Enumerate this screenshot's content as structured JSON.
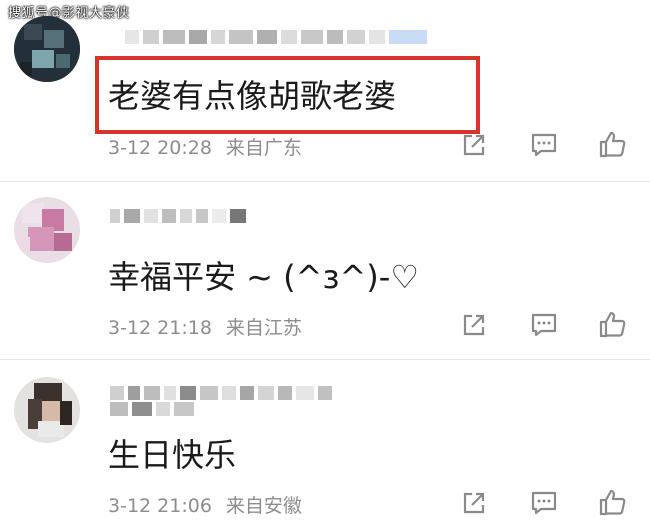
{
  "watermark": "搜狐号@影视大豪侠",
  "comments": [
    {
      "text": "老婆有点像胡歌老婆",
      "time": "3-12 20:28",
      "location": "来自广东",
      "highlighted": true
    },
    {
      "text": "幸福平安 ~ (^ɜ^)-♡",
      "time": "3-12 21:18",
      "location": "来自江苏",
      "highlighted": false
    },
    {
      "text": "生日快乐",
      "time": "3-12 21:06",
      "location": "来自安徽",
      "highlighted": false
    }
  ],
  "colors": {
    "highlight": "#d9342b",
    "meta": "#8d8d8d",
    "icon": "#8a8a8a"
  },
  "icons": [
    "share-icon",
    "reply-icon",
    "like-icon"
  ]
}
